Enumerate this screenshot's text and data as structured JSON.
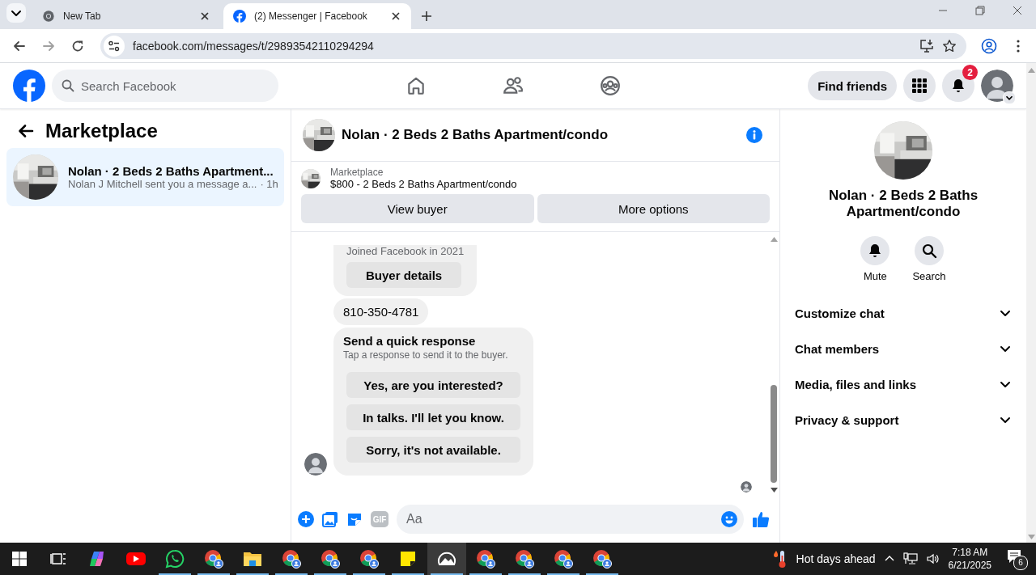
{
  "browser": {
    "tabs": [
      {
        "title": "New Tab",
        "kind": "chrome",
        "selected": false
      },
      {
        "title": "(2) Messenger | Facebook",
        "kind": "facebook",
        "selected": true
      }
    ],
    "url": "facebook.com/messages/t/29893542110294294"
  },
  "header": {
    "search": {
      "placeholder": "Search Facebook"
    },
    "nav": [
      {
        "kind": "home"
      },
      {
        "kind": "friends"
      },
      {
        "kind": "groups"
      }
    ],
    "find_friends": "Find friends",
    "notification_count": "2"
  },
  "sidebar": {
    "title": "Marketplace",
    "conversations": [
      {
        "title": "Nolan · 2 Beds 2 Baths Apartment...",
        "preview": "Nolan J Mitchell sent you a message a...",
        "time": "· 1h",
        "selected": true
      }
    ]
  },
  "chat": {
    "title": "Nolan · 2 Beds 2 Baths Apartment/condo",
    "listing": {
      "label": "Marketplace",
      "title": "$800 - 2 Beds 2 Baths Apartment/condo"
    },
    "actions": [
      "View buyer",
      "More options"
    ],
    "messages": [
      {
        "kind": "card",
        "caption": "Joined Facebook in 2021",
        "button": "Buyer details"
      },
      {
        "kind": "text",
        "text": "810-350-4781"
      },
      {
        "kind": "quick",
        "title": "Send a quick response",
        "subtitle": "Tap a response to send it to the buyer.",
        "options": [
          "Yes, are you interested?",
          "In talks. I'll let you know.",
          "Sorry, it's not available."
        ]
      }
    ],
    "composer": {
      "gif": "GIF",
      "placeholder": "Aa"
    }
  },
  "details": {
    "title": "Nolan · 2 Beds 2 Baths Apartment/condo",
    "actions": [
      {
        "kind": "bell",
        "label": "Mute"
      },
      {
        "kind": "search",
        "label": "Search"
      }
    ],
    "sections": [
      {
        "label": "Customize chat",
        "expanded": false
      },
      {
        "label": "Chat members",
        "expanded": false
      },
      {
        "label": "Media, files and links",
        "expanded": false
      },
      {
        "label": "Privacy & support",
        "expanded": false
      }
    ]
  },
  "taskbar": {
    "apps": [
      {
        "kind": "taskview",
        "running": false,
        "selected": false
      },
      {
        "kind": "copilot",
        "running": false,
        "selected": false
      },
      {
        "kind": "youtube",
        "running": false,
        "selected": false
      },
      {
        "kind": "whatsapp",
        "running": true,
        "selected": false
      },
      {
        "kind": "chrome",
        "running": true,
        "selected": false
      },
      {
        "kind": "folder",
        "running": true,
        "selected": false
      },
      {
        "kind": "chrome",
        "running": true,
        "selected": false
      },
      {
        "kind": "chrome",
        "running": true,
        "selected": false
      },
      {
        "kind": "chrome",
        "running": true,
        "selected": false
      },
      {
        "kind": "note",
        "running": true,
        "selected": false
      },
      {
        "kind": "photos",
        "running": true,
        "selected": true
      },
      {
        "kind": "chrome",
        "running": true,
        "selected": false
      },
      {
        "kind": "chrome",
        "running": true,
        "selected": false
      },
      {
        "kind": "chrome",
        "running": true,
        "selected": false
      },
      {
        "kind": "chrome",
        "running": true,
        "selected": false
      }
    ],
    "weather": "Hot days ahead",
    "time": "7:18 AM",
    "date": "6/21/2025",
    "notifications": "6"
  }
}
